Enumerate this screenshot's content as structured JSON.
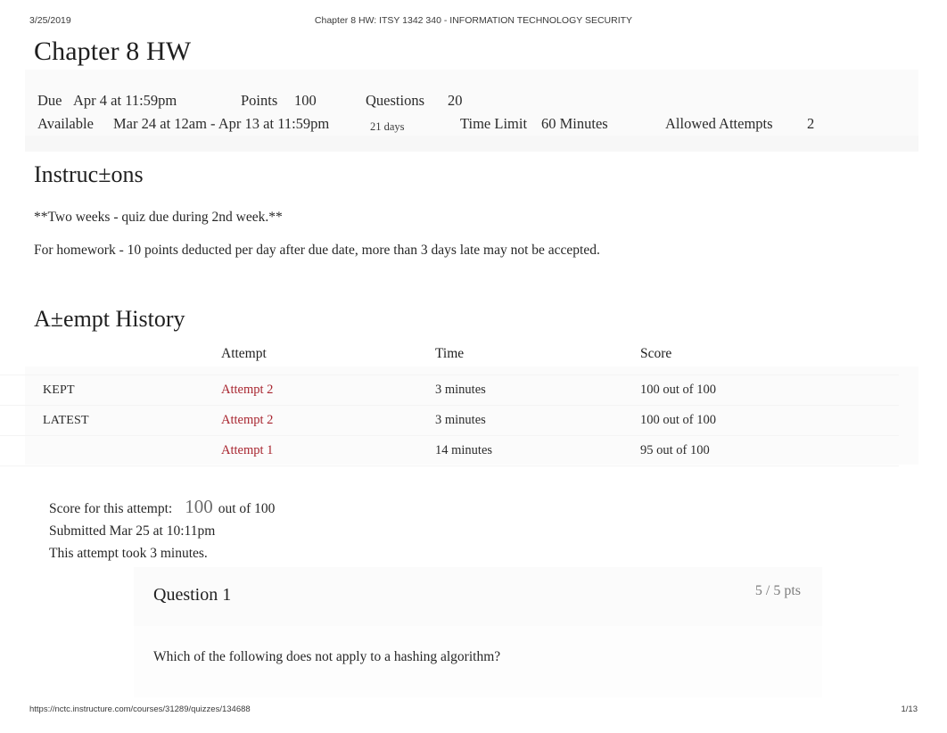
{
  "print_header": {
    "date": "3/25/2019",
    "document_title": "Chapter 8 HW: ITSY 1342 340 - INFORMATION TECHNOLOGY SECURITY"
  },
  "page_title": "Chapter 8 HW",
  "details": {
    "due_label": "Due",
    "due_value": "Apr 4 at 11:59pm",
    "points_label": "Points",
    "points_value": "100",
    "questions_label": "Questions",
    "questions_value": "20",
    "available_label": "Available",
    "available_value": "Mar 24 at 12am - Apr 13 at 11:59pm",
    "available_duration": "21 days",
    "time_limit_label": "Time Limit",
    "time_limit_value": "60 Minutes",
    "allowed_attempts_label": "Allowed Attempts",
    "allowed_attempts_value": "2"
  },
  "instructions": {
    "heading": "Instruc±ons",
    "paragraphs": [
      "**Two weeks - quiz due during 2nd week.**",
      "For homework - 10 points deducted per day after due date, more than 3 days late may not be accepted."
    ]
  },
  "attempt_history": {
    "heading": "A±empt History",
    "columns": [
      "",
      "Attempt",
      "Time",
      "Score"
    ],
    "rows": [
      {
        "badge": "KEPT",
        "attempt": "Attempt 2",
        "time": "3 minutes",
        "score": "100 out of 100"
      },
      {
        "badge": "LATEST",
        "attempt": "Attempt 2",
        "time": "3 minutes",
        "score": "100 out of 100"
      },
      {
        "badge": "",
        "attempt": "Attempt 1",
        "time": "14 minutes",
        "score": "95 out of 100"
      }
    ]
  },
  "summary": {
    "score_label": "Score for this attempt:",
    "score_value": "100",
    "score_out_of": "out of 100",
    "submitted": "Submitted Mar 25 at 10:11pm",
    "duration": "This attempt took 3 minutes."
  },
  "question": {
    "title": "Question 1",
    "points": "5 / 5 pts",
    "text": "Which of the following does not apply to a hashing algorithm?"
  },
  "print_footer": {
    "url": "https://nctc.instructure.com/courses/31289/quizzes/134688",
    "page": "1/13"
  },
  "colors": {
    "link_red": "#a8252f",
    "text": "#272727",
    "muted": "#7d7d7d",
    "band": "#fafafa"
  }
}
